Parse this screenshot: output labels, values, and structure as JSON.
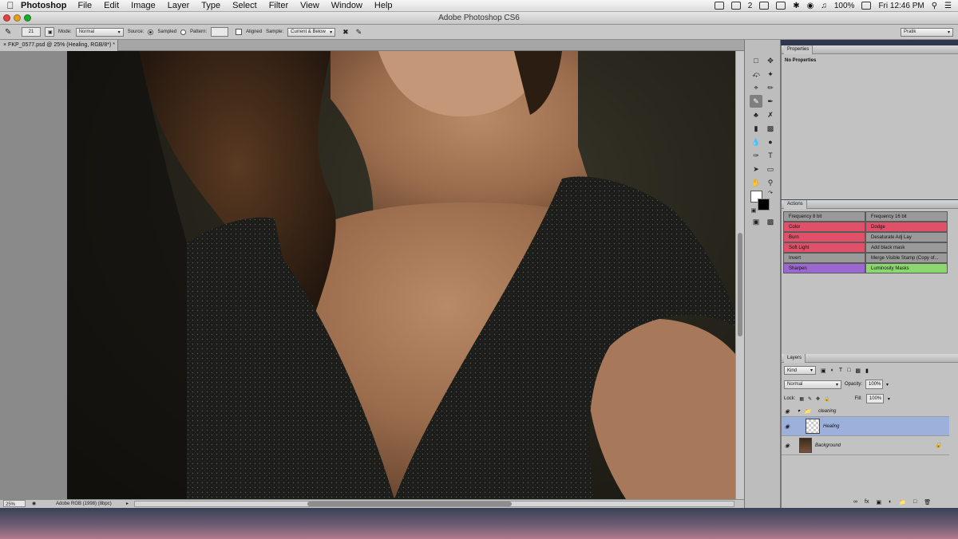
{
  "menubar": {
    "app_name": "Photoshop",
    "menus": [
      "File",
      "Edit",
      "Image",
      "Layer",
      "Type",
      "Select",
      "Filter",
      "View",
      "Window",
      "Help"
    ],
    "status_icon_label": "2",
    "battery": "100%",
    "clock": "Fri 12:46 PM"
  },
  "window": {
    "title": "Adobe Photoshop CS6"
  },
  "options": {
    "brush_size": "21",
    "mode_label": "Mode:",
    "mode_value": "Normal",
    "source_label": "Source:",
    "sampled_label": "Sampled",
    "pattern_label": "Pattern:",
    "aligned_label": "Aligned",
    "sample_label": "Sample:",
    "sample_value": "Current & Below",
    "workspace": "Pratik"
  },
  "document": {
    "tab_label": "FKP_0577.psd @ 25% (Healing, RGB/8*) *",
    "zoom": "25%",
    "profile": "Adobe RGB (1998) (8bpc)"
  },
  "properties": {
    "title": "Properties",
    "content": "No Properties"
  },
  "actions": {
    "title": "Actions",
    "buttons": [
      {
        "label": "Frequency 8 bit",
        "color": "#9a9a9a"
      },
      {
        "label": "Frequency 16 bit",
        "color": "#9a9a9a"
      },
      {
        "label": "Color",
        "color": "#e05068"
      },
      {
        "label": "Dodge",
        "color": "#e05068"
      },
      {
        "label": "Burn",
        "color": "#e05068"
      },
      {
        "label": "Desaturate Adj Lay",
        "color": "#9a9a9a"
      },
      {
        "label": "Soft Light",
        "color": "#e05068"
      },
      {
        "label": "Add black mask",
        "color": "#9a9a9a"
      },
      {
        "label": "Invert",
        "color": "#9a9a9a"
      },
      {
        "label": "Merge Visible Stamp (Copy of...",
        "color": "#9a9a9a"
      },
      {
        "label": "Sharpen",
        "color": "#9a68d0"
      },
      {
        "label": "Luminosity Masks",
        "color": "#8cd870"
      }
    ]
  },
  "layers": {
    "title": "Layers",
    "kind_filter": "Kind",
    "blend_mode": "Normal",
    "opacity_label": "Opacity:",
    "opacity_value": "100%",
    "lock_label": "Lock:",
    "fill_label": "Fill:",
    "fill_value": "100%",
    "items": [
      {
        "name": "cleaning",
        "type": "group"
      },
      {
        "name": "Healing",
        "type": "layer",
        "selected": true
      },
      {
        "name": "Background",
        "type": "background",
        "locked": true
      }
    ]
  }
}
